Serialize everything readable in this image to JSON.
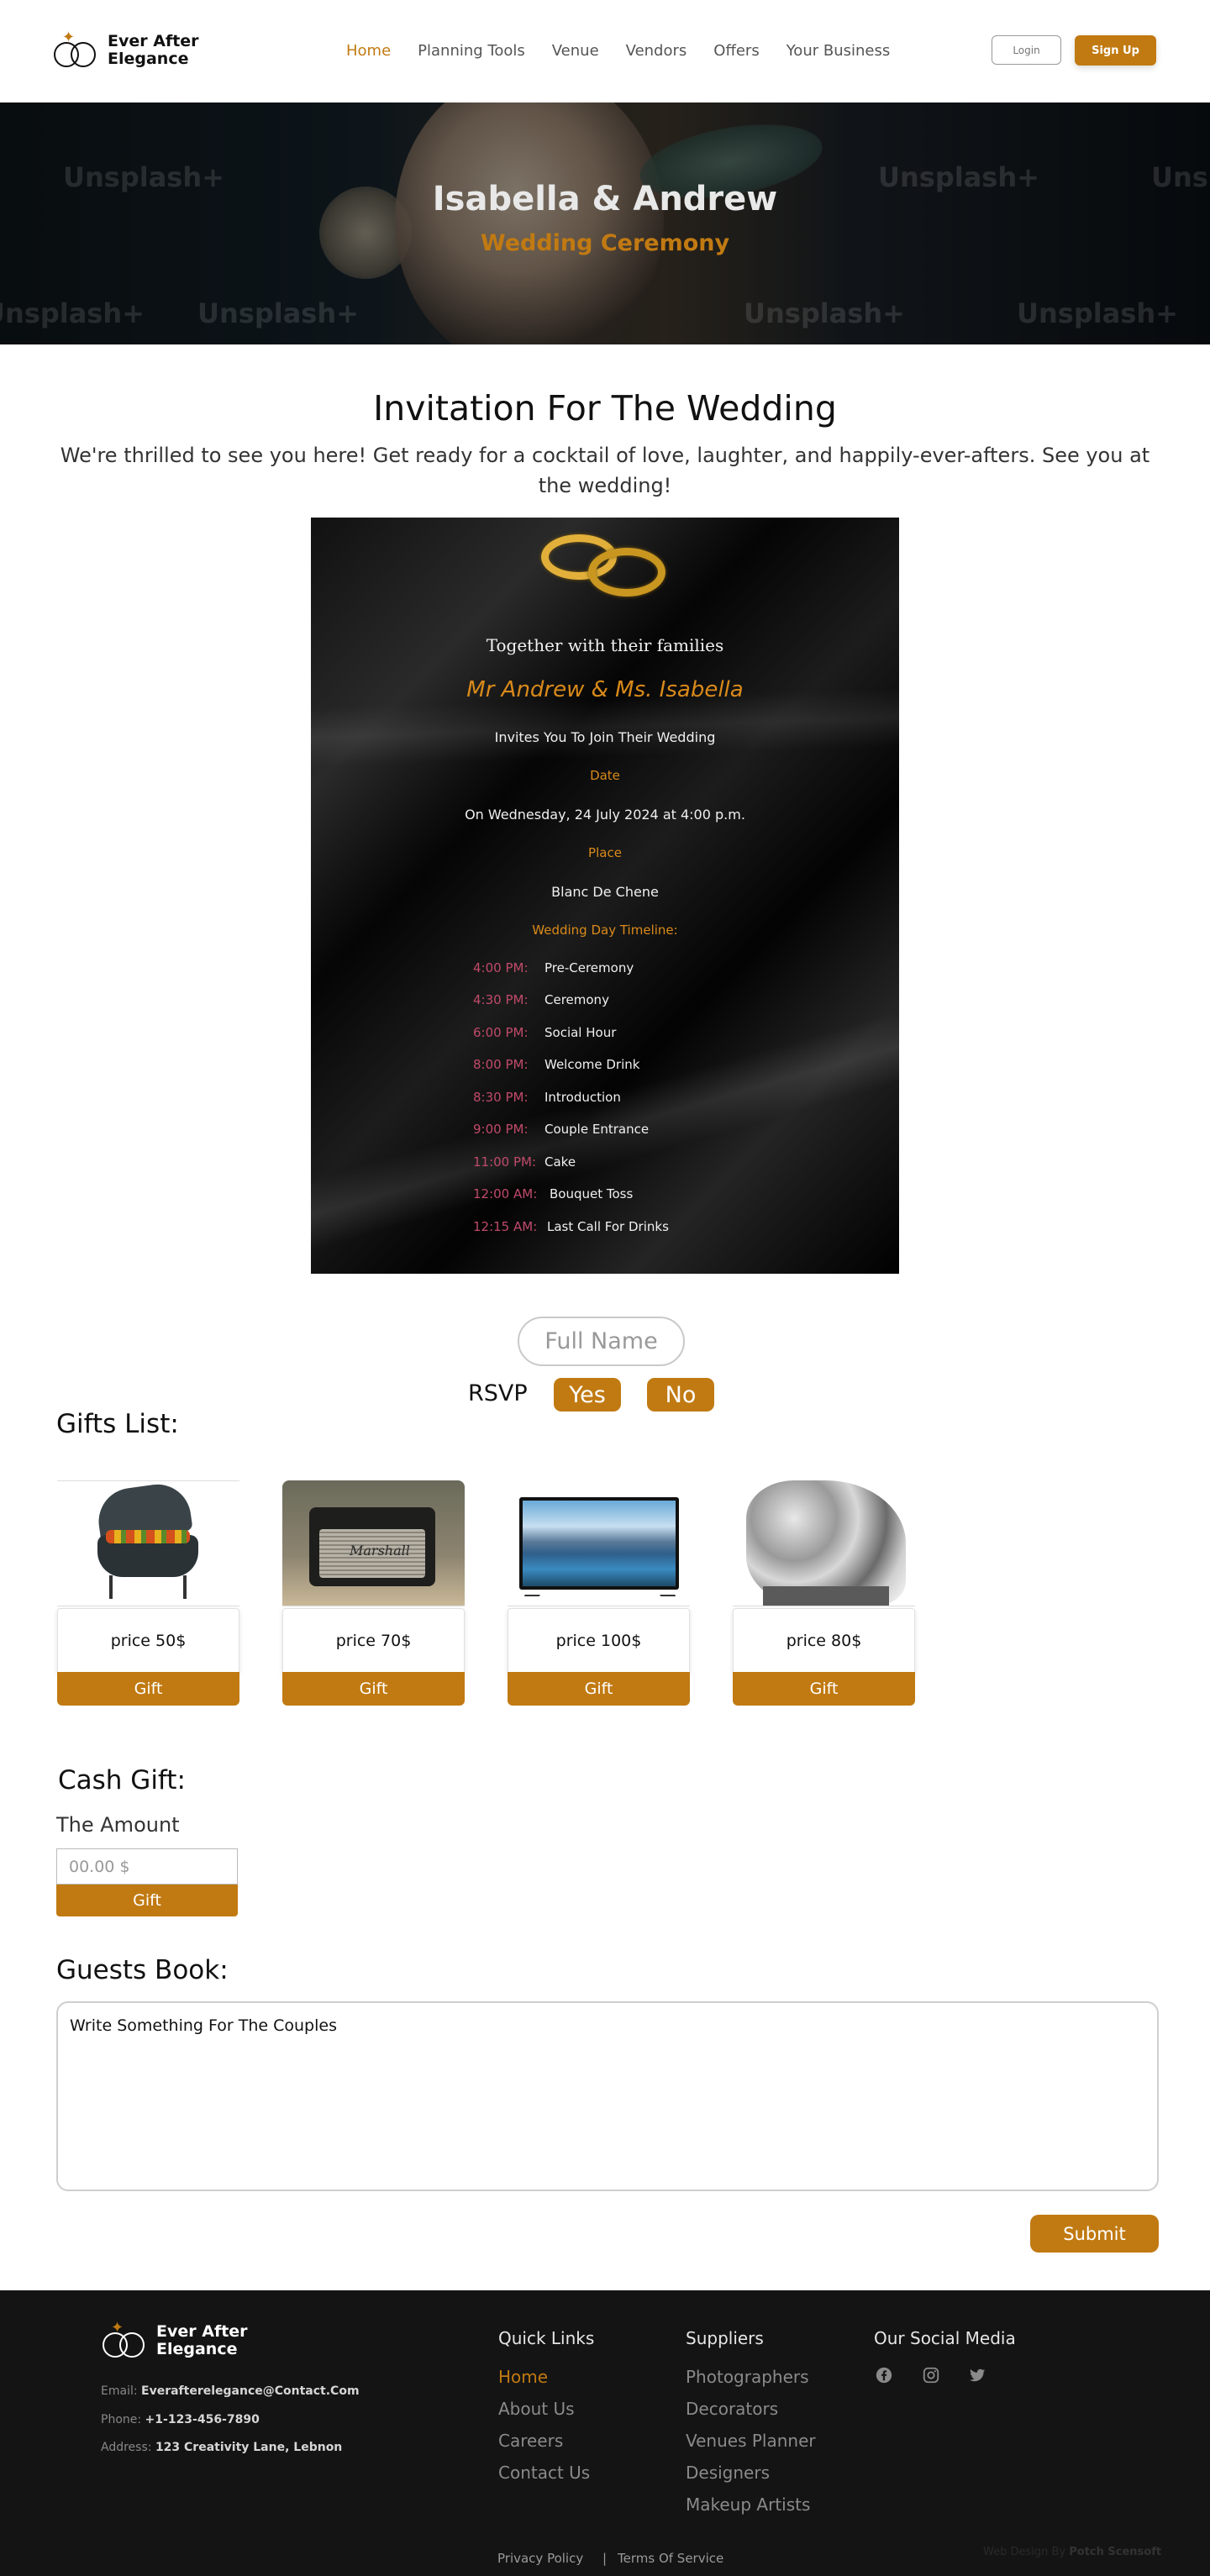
{
  "nav": {
    "brand_line1": "Ever After",
    "brand_line2": "Elegance",
    "links": [
      "Home",
      "Planning Tools",
      "Venue",
      "Vendors",
      "Offers",
      "Your Business"
    ],
    "login": "Login",
    "signup": "Sign Up"
  },
  "hero": {
    "title": "Isabella & Andrew",
    "subtitle": "Wedding Ceremony",
    "watermark": "Unsplash+"
  },
  "invitation": {
    "heading": "Invitation For The Wedding",
    "text": "We're thrilled to see you here! Get ready for a cocktail of love, laughter, and happily-ever-afters. See you at the wedding!",
    "card": {
      "together": "Together with their families",
      "names": "Mr Andrew & Ms. Isabella",
      "invites": "Invites You To Join Their Wedding",
      "date_label": "Date",
      "date": "On Wednesday, 24 July 2024 at 4:00 p.m.",
      "place_label": "Place",
      "place": "Blanc De Chene",
      "timeline_label": "Wedding Day Timeline:",
      "timeline": [
        {
          "time": "4:00 PM:",
          "event": "Pre-Ceremony"
        },
        {
          "time": "4:30 PM:",
          "event": "Ceremony"
        },
        {
          "time": "6:00 PM:",
          "event": "Social Hour"
        },
        {
          "time": "8:00 PM:",
          "event": "Welcome Drink"
        },
        {
          "time": "8:30 PM:",
          "event": "Introduction"
        },
        {
          "time": "9:00 PM:",
          "event": "Couple Entrance"
        },
        {
          "time": "11:00 PM:",
          "event": "Cake"
        },
        {
          "time": "12:00 AM:",
          "event": "Bouquet Toss"
        },
        {
          "time": "12:15 AM:",
          "event": "Last Call For Drinks"
        }
      ]
    }
  },
  "rsvp": {
    "name_placeholder": "Full Name",
    "label": "RSVP",
    "yes": "Yes",
    "no": "No"
  },
  "gifts": {
    "heading": "Gifts List:",
    "items": [
      {
        "price": "price 50$",
        "button": "Gift",
        "icon": "grill-image"
      },
      {
        "price": "price 70$",
        "button": "Gift",
        "icon": "speaker-image",
        "brand": "Marshall"
      },
      {
        "price": "price 100$",
        "button": "Gift",
        "icon": "tv-image"
      },
      {
        "price": "price 80$",
        "button": "Gift",
        "icon": "sculpture-image"
      }
    ]
  },
  "cash": {
    "heading": "Cash Gift:",
    "amount_label": "The Amount",
    "amount_placeholder": "00.00 $",
    "button": "Gift"
  },
  "guestbook": {
    "heading": "Guests Book:",
    "placeholder": "Write Something For The Couples",
    "submit": "Submit"
  },
  "footer": {
    "brand_line1": "Ever After",
    "brand_line2": "Elegance",
    "email_label": "Email:",
    "email": "Everafterelegance@Contact.Com",
    "phone_label": "Phone:",
    "phone": "+1-123-456-7890",
    "address_label": "Address:",
    "address": "123 Creativity Lane, Lebnon",
    "quick_links_title": "Quick Links",
    "quick_links": [
      "Home",
      "About Us",
      "Careers",
      "Contact Us"
    ],
    "suppliers_title": "Suppliers",
    "suppliers": [
      "Photographers",
      "Decorators",
      "Venues Planner",
      "Designers",
      "Makeup Artists"
    ],
    "social_title": "Our Social Media",
    "social_icons": [
      "facebook-icon",
      "instagram-icon",
      "twitter-icon"
    ],
    "privacy": "Privacy Policy",
    "separator": "|",
    "terms": "Terms Of Service",
    "credit_prefix": "Web Design By",
    "credit_name": "Potch Scensoft"
  },
  "colors": {
    "accent": "#c17a12",
    "footer_bg": "#141414",
    "timeline_time": "#c04a6a"
  }
}
